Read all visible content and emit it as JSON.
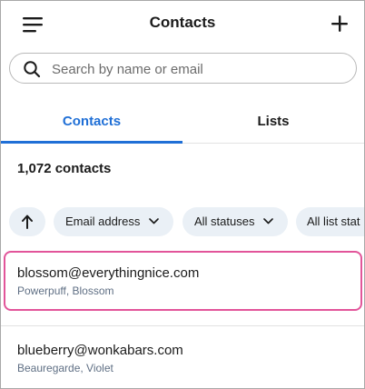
{
  "header": {
    "title": "Contacts",
    "menu_icon": "hamburger-menu-icon",
    "add_icon": "plus-icon"
  },
  "search": {
    "placeholder": "Search by name or email",
    "value": ""
  },
  "tabs": [
    {
      "label": "Contacts",
      "active": true
    },
    {
      "label": "Lists",
      "active": false
    }
  ],
  "count_label": "1,072 contacts",
  "filters": {
    "sort_icon": "arrow-up-icon",
    "chips": [
      {
        "label": "Email address",
        "icon": "chevron-down-icon"
      },
      {
        "label": "All statuses",
        "icon": "chevron-down-icon"
      },
      {
        "label": "All list stat",
        "icon": "chevron-down-icon"
      }
    ]
  },
  "contacts": [
    {
      "email": "blossom@everythingnice.com",
      "name": "Powerpuff, Blossom",
      "selected": true
    },
    {
      "email": "blueberry@wonkabars.com",
      "name": "Beauregarde, Violet",
      "selected": false
    }
  ],
  "colors": {
    "accent": "#1f6fd6",
    "selected_border": "#e2559a",
    "chip_bg": "#eaf0f6",
    "secondary_text": "#5f6f84"
  }
}
